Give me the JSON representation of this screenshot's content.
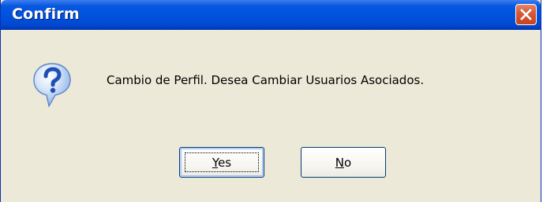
{
  "window": {
    "title": "Confirm",
    "close_icon": "close-icon"
  },
  "dialog": {
    "icon": "question-icon",
    "message": "Cambio de Perfil. Desea Cambiar Usuarios Asociados."
  },
  "buttons": {
    "yes": {
      "mnemonic": "Y",
      "rest": "es",
      "focused": true
    },
    "no": {
      "mnemonic": "N",
      "rest": "o",
      "focused": false
    }
  },
  "colors": {
    "titlebar": "#0153DE",
    "dialog_bg": "#ECE9D8",
    "close_button": "#D85A3A",
    "icon_blue": "#2B5FC8"
  }
}
